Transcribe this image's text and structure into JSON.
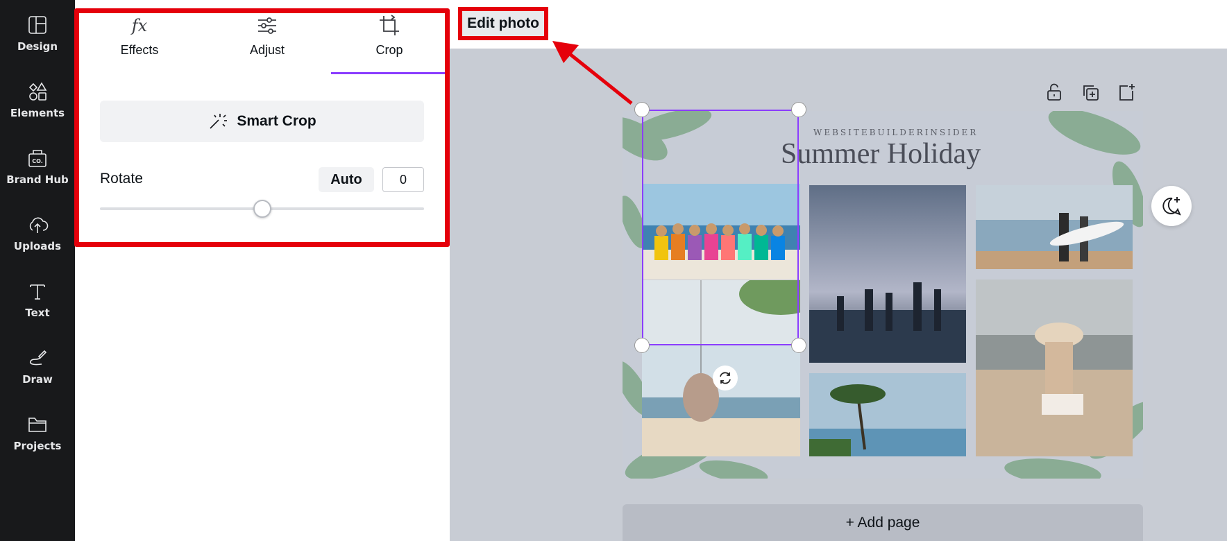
{
  "rail": {
    "items": [
      {
        "label": "Design",
        "icon": "layout-icon"
      },
      {
        "label": "Elements",
        "icon": "shapes-icon"
      },
      {
        "label": "Brand Hub",
        "icon": "brand-kit-icon"
      },
      {
        "label": "Uploads",
        "icon": "cloud-upload-icon"
      },
      {
        "label": "Text",
        "icon": "text-icon"
      },
      {
        "label": "Draw",
        "icon": "draw-icon"
      },
      {
        "label": "Projects",
        "icon": "folder-icon"
      }
    ],
    "brand_badge": "CO."
  },
  "panel": {
    "tabs": [
      {
        "label": "Effects",
        "icon": "fx-icon"
      },
      {
        "label": "Adjust",
        "icon": "sliders-icon"
      },
      {
        "label": "Crop",
        "icon": "crop-icon"
      }
    ],
    "fx_glyph": "fx",
    "active_tab": "Crop",
    "smart_crop_label": "Smart Crop",
    "rotate_label": "Rotate",
    "auto_label": "Auto",
    "rotate_value": "0",
    "rotate_fraction": 0.5
  },
  "topbar": {
    "edit_photo_label": "Edit photo"
  },
  "design": {
    "brand": "WEBSITEBUILDERINSIDER",
    "title": "Summer Holiday",
    "add_page_label": "+ Add page"
  },
  "colors": {
    "accent": "#8b3dff",
    "highlight": "#e5000b",
    "rail_bg": "#18191b",
    "workspace_bg": "#c8ccd4"
  }
}
